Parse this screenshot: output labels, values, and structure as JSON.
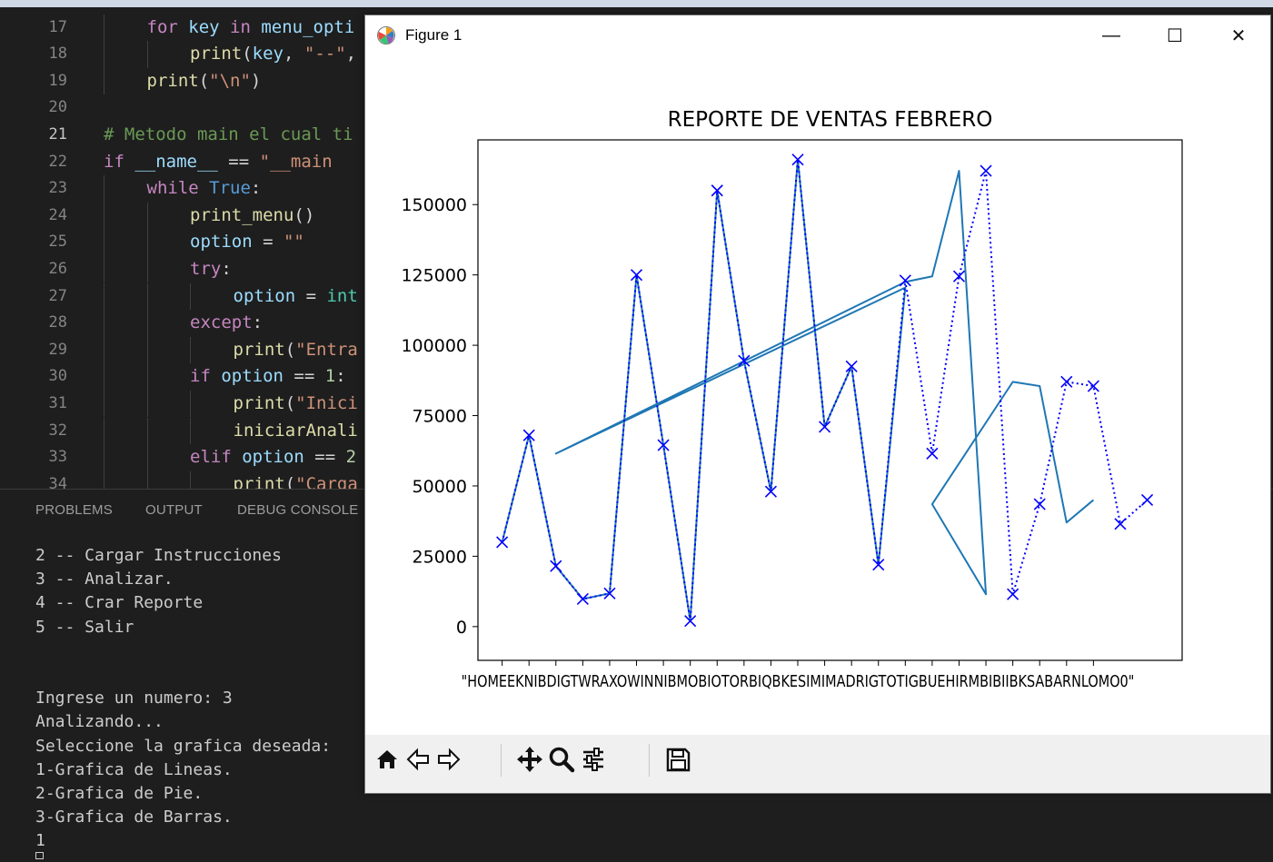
{
  "editor": {
    "lines": [
      {
        "num": "17",
        "indent": 1,
        "tokens": [
          [
            "kw",
            "for "
          ],
          [
            "var",
            "key "
          ],
          [
            "kw",
            "in "
          ],
          [
            "var",
            "menu_opti"
          ]
        ]
      },
      {
        "num": "18",
        "indent": 2,
        "tokens": [
          [
            "fn",
            "print"
          ],
          [
            "op",
            "("
          ],
          [
            "var",
            "key"
          ],
          [
            "op",
            ", "
          ],
          [
            "str",
            "\"--\""
          ],
          [
            "op",
            ","
          ]
        ]
      },
      {
        "num": "19",
        "indent": 1,
        "tokens": [
          [
            "fn",
            "print"
          ],
          [
            "op",
            "("
          ],
          [
            "str",
            "\"\\n\""
          ],
          [
            "op",
            ")"
          ]
        ]
      },
      {
        "num": "20",
        "indent": 0,
        "tokens": []
      },
      {
        "num": "21",
        "indent": 0,
        "active": true,
        "tokens": [
          [
            "cm",
            "# Metodo main el cual ti"
          ]
        ]
      },
      {
        "num": "22",
        "indent": 0,
        "tokens": [
          [
            "kw",
            "if "
          ],
          [
            "var",
            "__name__ "
          ],
          [
            "op",
            "== "
          ],
          [
            "str",
            "\"__main"
          ]
        ]
      },
      {
        "num": "23",
        "indent": 1,
        "tokens": [
          [
            "kw",
            "while "
          ],
          [
            "kw2",
            "True"
          ],
          [
            "op",
            ":"
          ]
        ]
      },
      {
        "num": "24",
        "indent": 2,
        "tokens": [
          [
            "fn",
            "print_menu"
          ],
          [
            "op",
            "()"
          ]
        ]
      },
      {
        "num": "25",
        "indent": 2,
        "tokens": [
          [
            "var",
            "option "
          ],
          [
            "op",
            "= "
          ],
          [
            "str",
            "\"\""
          ]
        ]
      },
      {
        "num": "26",
        "indent": 2,
        "tokens": [
          [
            "kw",
            "try"
          ],
          [
            "op",
            ":"
          ]
        ]
      },
      {
        "num": "27",
        "indent": 3,
        "tokens": [
          [
            "var",
            "option "
          ],
          [
            "op",
            "= "
          ],
          [
            "type",
            "int"
          ]
        ]
      },
      {
        "num": "28",
        "indent": 2,
        "tokens": [
          [
            "kw",
            "except"
          ],
          [
            "op",
            ":"
          ]
        ]
      },
      {
        "num": "29",
        "indent": 3,
        "tokens": [
          [
            "fn",
            "print"
          ],
          [
            "op",
            "("
          ],
          [
            "str",
            "\"Entra"
          ]
        ]
      },
      {
        "num": "30",
        "indent": 2,
        "tokens": [
          [
            "kw",
            "if "
          ],
          [
            "var",
            "option "
          ],
          [
            "op",
            "== "
          ],
          [
            "num",
            "1"
          ],
          [
            "op",
            ":"
          ]
        ]
      },
      {
        "num": "31",
        "indent": 3,
        "tokens": [
          [
            "fn",
            "print"
          ],
          [
            "op",
            "("
          ],
          [
            "str",
            "\"Inici"
          ]
        ]
      },
      {
        "num": "32",
        "indent": 3,
        "tokens": [
          [
            "fn",
            "iniciarAnali"
          ]
        ]
      },
      {
        "num": "33",
        "indent": 2,
        "tokens": [
          [
            "kw",
            "elif "
          ],
          [
            "var",
            "option "
          ],
          [
            "op",
            "== "
          ],
          [
            "num",
            "2"
          ]
        ]
      },
      {
        "num": "34",
        "indent": 3,
        "tokens": [
          [
            "fn",
            "print"
          ],
          [
            "op",
            "("
          ],
          [
            "str",
            "\"Carga"
          ]
        ]
      }
    ]
  },
  "panel": {
    "tabs": [
      "PROBLEMS",
      "OUTPUT",
      "DEBUG CONSOLE"
    ],
    "terminal_lines": [
      "2 -- Cargar Instrucciones",
      "3 -- Analizar.",
      "4 -- Crar Reporte",
      "5 -- Salir",
      "",
      "",
      "Ingrese un numero: 3",
      "Analizando...",
      "Seleccione la grafica deseada:",
      "1-Grafica de Lineas.",
      "2-Grafica de Pie.",
      "3-Grafica de Barras.",
      "1"
    ]
  },
  "figure": {
    "window_title": "Figure 1",
    "minimize_glyph": "—",
    "maximize_glyph": "☐",
    "close_glyph": "✕",
    "toolbar_icons": [
      "home-icon",
      "back-arrow-icon",
      "forward-arrow-icon",
      "pan-icon",
      "zoom-icon",
      "configure-subplots-icon",
      "save-icon"
    ]
  },
  "chart_data": {
    "type": "line",
    "title": "REPORTE DE VENTAS FEBRERO",
    "xlabel": "",
    "ylabel": "",
    "ylim": [
      -12000,
      173000
    ],
    "yticks": [
      0,
      25000,
      50000,
      75000,
      100000,
      125000,
      150000
    ],
    "ytick_labels": [
      "0",
      "25000",
      "50000",
      "75000",
      "100000",
      "125000",
      "150000"
    ],
    "xlim": [
      -0.9,
      25.3
    ],
    "x_tick_label_text": "\"HOMEEKNIBDIGTWRAXOWINNIBMOBIOTORBIQBKESIMIMADRIGTOTIGBUEHIRMBIBIIBKSABARNLOMO0\"",
    "x_tick_count": 23,
    "series": [
      {
        "style": "solid",
        "color": "#1f77b4",
        "points": [
          [
            0,
            30000
          ],
          [
            1,
            68000
          ],
          [
            2,
            21500
          ],
          [
            3,
            9800
          ],
          [
            4,
            11800
          ],
          [
            5,
            125000
          ],
          [
            6,
            64500
          ],
          [
            7,
            2000
          ],
          [
            8,
            155000
          ],
          [
            9,
            94500
          ],
          [
            10,
            48000
          ],
          [
            11,
            166000
          ],
          [
            12,
            71000
          ],
          [
            13,
            92500
          ],
          [
            14,
            22000
          ],
          [
            15,
            120500
          ],
          [
            2,
            61500
          ],
          [
            15,
            122500
          ],
          [
            16,
            124500
          ],
          [
            17,
            162000
          ],
          [
            18,
            11500
          ],
          [
            16,
            43500
          ],
          [
            19,
            87000
          ],
          [
            20,
            85500
          ],
          [
            21,
            37000
          ],
          [
            22,
            45000
          ]
        ]
      },
      {
        "style": "dotted",
        "color": "#0000ff",
        "marker": "x",
        "points": [
          [
            0,
            30000
          ],
          [
            1,
            68000
          ],
          [
            2,
            21500
          ],
          [
            3,
            9800
          ],
          [
            4,
            11800
          ],
          [
            5,
            125000
          ],
          [
            6,
            64500
          ],
          [
            7,
            2000
          ],
          [
            8,
            155000
          ],
          [
            9,
            94500
          ],
          [
            10,
            48000
          ],
          [
            11,
            166000
          ],
          [
            12,
            71000
          ],
          [
            13,
            92500
          ],
          [
            14,
            22000
          ],
          [
            15,
            123000
          ],
          [
            16,
            61500
          ],
          [
            17,
            124500
          ],
          [
            18,
            162000
          ],
          [
            19,
            11500
          ],
          [
            20,
            43500
          ],
          [
            21,
            87000
          ],
          [
            22,
            85500
          ],
          [
            23,
            36500
          ],
          [
            24,
            45000
          ]
        ]
      }
    ]
  }
}
